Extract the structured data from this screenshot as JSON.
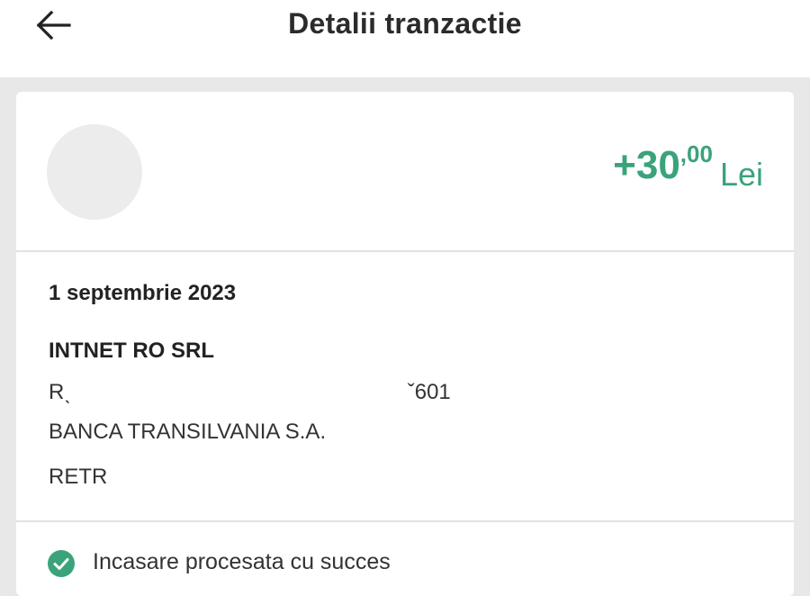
{
  "header": {
    "title": "Detalii tranzactie",
    "back_icon": "arrow-left-icon"
  },
  "transaction": {
    "amount_integer": "+30",
    "amount_decimal": ",00",
    "currency": "Lei",
    "amount_color": "#3aa37a",
    "date": "1 septembrie 2023",
    "counterparty": "INTNET RO SRL",
    "iban_masked": "Rˎ                                                        ˇ601",
    "bank": "BANCA TRANSILVANIA S.A.",
    "reference": "RETR"
  },
  "status": {
    "icon": "check-circle-icon",
    "icon_color": "#3aa37a",
    "text": "Incasare procesata cu succes"
  }
}
